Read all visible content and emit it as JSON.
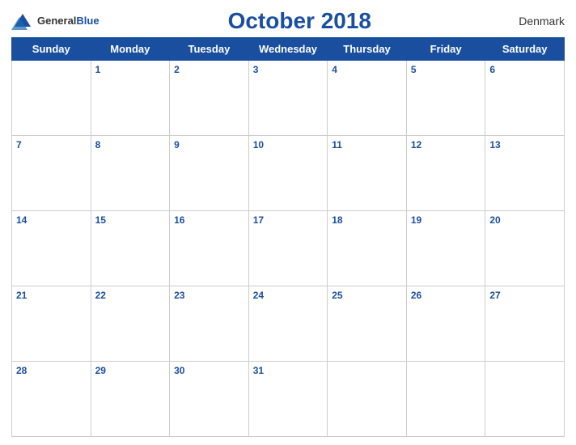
{
  "header": {
    "title": "October 2018",
    "country": "Denmark",
    "logo": {
      "general": "General",
      "blue": "Blue"
    }
  },
  "weekdays": [
    "Sunday",
    "Monday",
    "Tuesday",
    "Wednesday",
    "Thursday",
    "Friday",
    "Saturday"
  ],
  "weeks": [
    [
      null,
      1,
      2,
      3,
      4,
      5,
      6
    ],
    [
      7,
      8,
      9,
      10,
      11,
      12,
      13
    ],
    [
      14,
      15,
      16,
      17,
      18,
      19,
      20
    ],
    [
      21,
      22,
      23,
      24,
      25,
      26,
      27
    ],
    [
      28,
      29,
      30,
      31,
      null,
      null,
      null
    ]
  ],
  "colors": {
    "header_bg": "#1a4fa0",
    "row_stripe": "#d6dff2"
  }
}
